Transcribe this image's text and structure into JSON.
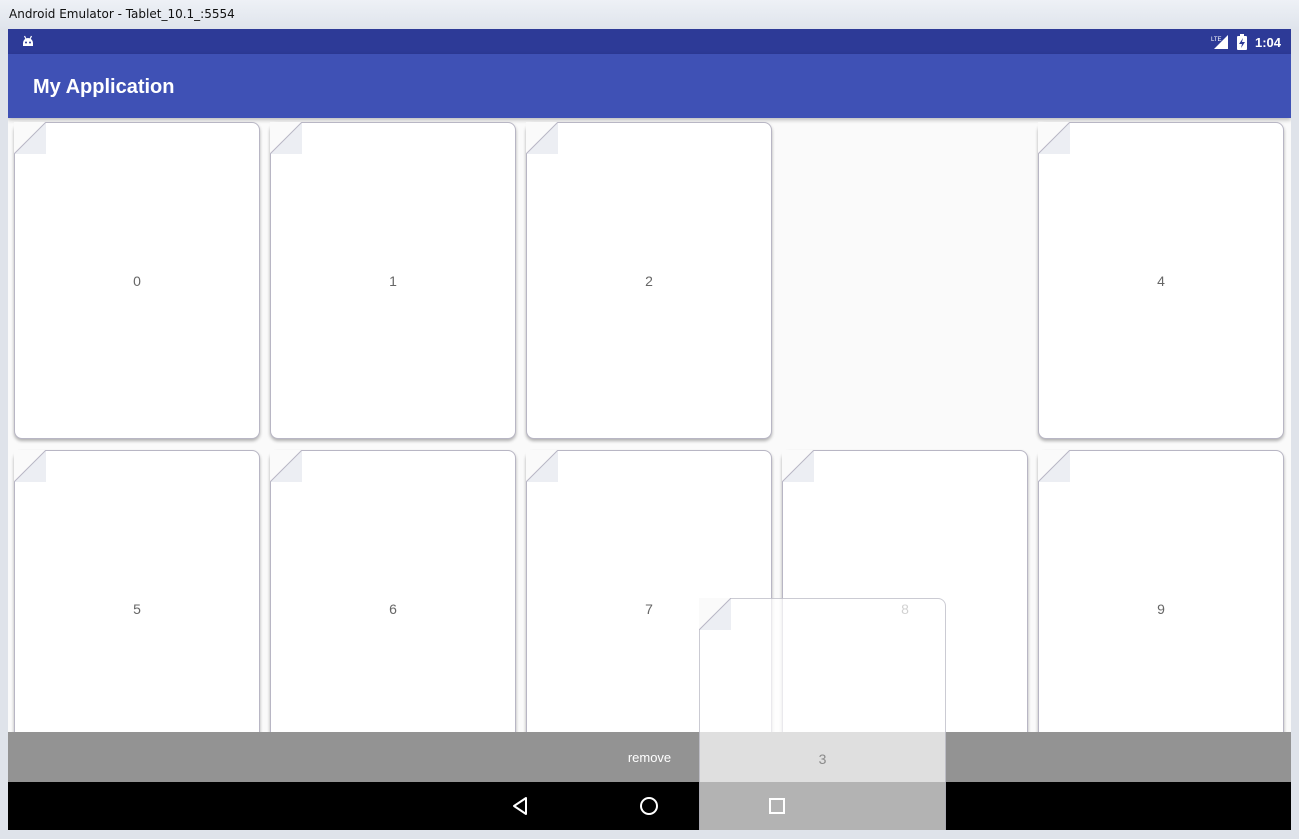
{
  "window": {
    "title": "Android Emulator - Tablet_10.1_:5554"
  },
  "status_bar": {
    "time": "1:04",
    "network": "LTE",
    "icons": [
      "android-debug-icon",
      "signal-icon",
      "battery-charging-icon"
    ]
  },
  "app_bar": {
    "title": "My Application"
  },
  "cards": [
    {
      "label": "0"
    },
    {
      "label": "1"
    },
    {
      "label": "2"
    },
    {
      "label": "4"
    },
    {
      "label": "5"
    },
    {
      "label": "6"
    },
    {
      "label": "7"
    },
    {
      "label": "8"
    },
    {
      "label": "9"
    }
  ],
  "dragging_card": {
    "label": "3"
  },
  "bottom_bar": {
    "remove_label": "remove"
  },
  "nav": {
    "icons": [
      "back-icon",
      "home-icon",
      "recents-icon"
    ]
  },
  "colors": {
    "status_bar": "#2d3a97",
    "app_bar": "#3f51b5",
    "remove_bar": "#939393",
    "nav_bar": "#000000"
  }
}
